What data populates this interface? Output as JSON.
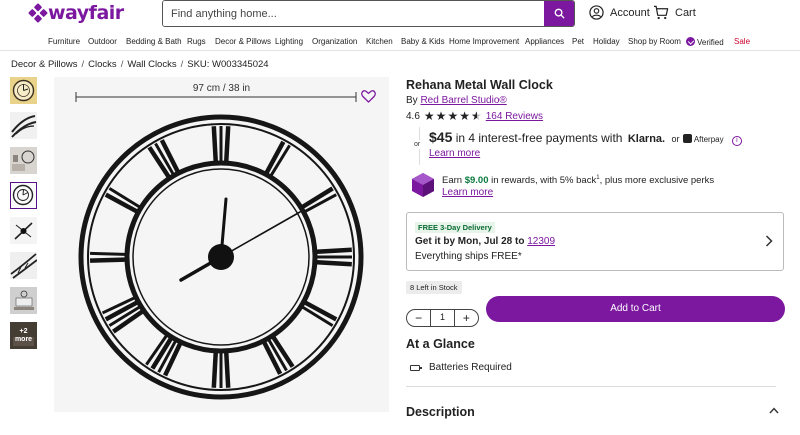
{
  "brand": {
    "logo_text": "wayfair",
    "accent": "#7b189f"
  },
  "search": {
    "placeholder": "Find anything home...",
    "icon": "search-icon"
  },
  "header": {
    "account_label": "Account",
    "cart_label": "Cart"
  },
  "nav": [
    "Furniture",
    "Outdoor",
    "Bedding & Bath",
    "Rugs",
    "Decor & Pillows",
    "Lighting",
    "Organization",
    "Kitchen",
    "Baby & Kids",
    "Home Improvement",
    "Appliances",
    "Pet",
    "Holiday",
    "Shop by Room",
    "Verified",
    "Sale"
  ],
  "breadcrumb": {
    "items": [
      "Decor & Pillows",
      "Clocks",
      "Wall Clocks"
    ],
    "sku": "SKU: W003345024"
  },
  "gallery": {
    "thumb_count": 8,
    "active_thumb": 4,
    "more_label": "+2 more",
    "dimension_label": "97 cm / 38 in"
  },
  "product": {
    "title": "Rehana Metal Wall Clock",
    "by_prefix": "By",
    "brand": "Red Barrel Studio®",
    "rating_value": "4.6",
    "rating": 4.6,
    "reviews": "164 Reviews"
  },
  "payment": {
    "or_label": "or",
    "amount": "$45",
    "text": "in 4 interest-free payments",
    "with": "with",
    "klarna": "Klarna.",
    "or2": "or",
    "afterpay": "Afterpay",
    "learn_more": "Learn more"
  },
  "rewards": {
    "prefix": "Earn",
    "amount": "$9.00",
    "suffix": "in rewards, with 5% back",
    "sup": "1",
    "tail": ", plus more exclusive perks",
    "learn_more": "Learn more"
  },
  "delivery": {
    "badge": "FREE 3-Day Delivery",
    "date_text": "Get it by Mon, Jul 28 to",
    "zip": "12309",
    "ships": "Everything ships FREE*"
  },
  "purchase": {
    "stock": "8 Left in Stock",
    "quantity": "1",
    "add_to_cart": "Add to Cart"
  },
  "glance": {
    "title": "At a Glance",
    "battery": "Batteries Required"
  },
  "description": {
    "title": "Description"
  }
}
